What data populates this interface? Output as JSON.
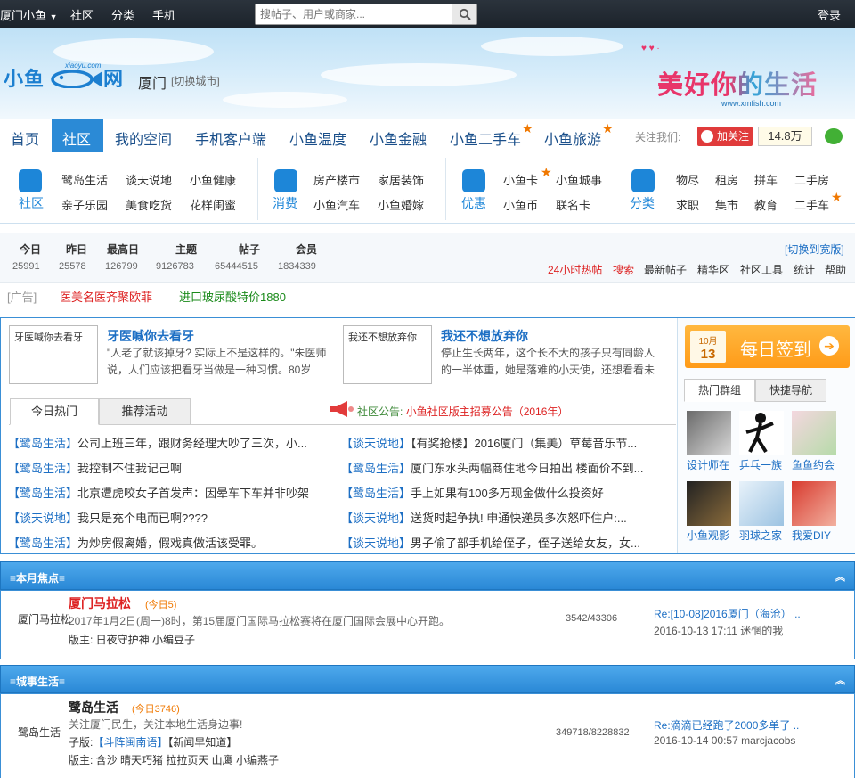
{
  "topbar": {
    "city_menu": "厦门小鱼",
    "community": "社区",
    "category": "分类",
    "mobile": "手机",
    "search_placeholder": "搜帖子、用户或商家...",
    "login": "登录"
  },
  "header": {
    "logo_text": "小鱼",
    "logo_text2": "网",
    "city": "厦门",
    "switch_city": "[切换城市]",
    "slogan": "美好你的生活",
    "slogan_url": "www.xmfish.com",
    "logo_url": "xiaoyu.com"
  },
  "nav": {
    "items": [
      "首页",
      "社区",
      "我的空间",
      "手机客户端",
      "小鱼温度",
      "小鱼金融",
      "小鱼二手车",
      "小鱼旅游"
    ],
    "follow_label": "关注我们:",
    "weibo_label": "加关注",
    "weibo_count": "14.8万"
  },
  "categories": [
    {
      "label": "社区",
      "links": [
        "鹭岛生活",
        "谈天说地",
        "小鱼健康",
        "亲子乐园",
        "美食吃货",
        "花样闺蜜"
      ]
    },
    {
      "label": "消费",
      "links": [
        "房产楼市",
        "家居装饰",
        "小鱼汽车",
        "小鱼婚嫁"
      ]
    },
    {
      "label": "优惠",
      "links": [
        "小鱼卡",
        "小鱼城事",
        "小鱼币",
        "联名卡"
      ]
    },
    {
      "label": "分类",
      "links": [
        "物尽",
        "租房",
        "拼车",
        "二手房",
        "求职",
        "集市",
        "教育",
        "二手车"
      ]
    }
  ],
  "stats": {
    "headers": [
      "今日",
      "昨日",
      "最高日",
      "主题",
      "帖子",
      "会员"
    ],
    "values": [
      "25991",
      "25578",
      "126799",
      "9126783",
      "65444515",
      "1834339"
    ],
    "switch_wide": "[切换到宽版]",
    "quick_links": [
      "24小时热帖",
      "搜索",
      "最新帖子",
      "精华区",
      "社区工具",
      "统计",
      "帮助"
    ]
  },
  "ads": {
    "label": "[广告]",
    "ad1": "医美名医齐聚欧菲",
    "ad2": "进口玻尿酸特价1880"
  },
  "featured": [
    {
      "thumb": "牙医喊你去看牙",
      "title": "牙医喊你去看牙",
      "desc": "\"人老了就该掉牙? 实际上不是这样的。\"朱医师说，人们应该把看牙当做是一种习惯。80岁"
    },
    {
      "thumb": "我还不想放弃你",
      "title": "我还不想放弃你",
      "desc": "停止生长两年，这个长不大的孩子只有同龄人的一半体重，她是落难的小天使，还想看看未"
    }
  ],
  "tabs": {
    "hot": "今日热门",
    "events": "推荐活动"
  },
  "notice": {
    "prefix": "社区公告:",
    "text": "小鱼社区版主招募公告（2016年）"
  },
  "hot_left": [
    {
      "forum": "【鹭岛生活】",
      "title": "公司上班三年，跟财务经理大吵了三次，小..."
    },
    {
      "forum": "【鹭岛生活】",
      "title": "我控制不住我记己啊"
    },
    {
      "forum": "【鹭岛生活】",
      "title": "北京遭虎咬女子首发声：因晕车下车并非吵架"
    },
    {
      "forum": "【谈天说地】",
      "title": "我只是充个电而已啊????"
    },
    {
      "forum": "【鹭岛生活】",
      "title": "为炒房假离婚，假戏真做活该受罪。"
    }
  ],
  "hot_right": [
    {
      "forum": "【谈天说地】",
      "title": "【有奖抢楼】2016厦门（集美）草莓音乐节..."
    },
    {
      "forum": "【鹭岛生活】",
      "title": "厦门东水头两幅商住地今日拍出 楼面价不到..."
    },
    {
      "forum": "【鹭岛生活】",
      "title": "手上如果有100多万现金做什么投资好"
    },
    {
      "forum": "【谈天说地】",
      "title": "送货时起争执! 申通快递员多次怒吓住户:..."
    },
    {
      "forum": "【谈天说地】",
      "title": "男子偷了部手机给侄子，侄子送给女友，女..."
    }
  ],
  "side": {
    "month": "10月",
    "day": "13",
    "sign_label": "每日签到",
    "tabs": [
      "热门群组",
      "快捷导航"
    ],
    "groups": [
      "设计师在",
      "乒乓一族",
      "鱼鱼约会",
      "小鱼观影",
      "羽球之家",
      "我爱DIY"
    ]
  },
  "sections": [
    {
      "title": "≡本月焦点≡",
      "forum_side": "厦门马拉松",
      "forum_name": "厦门马拉松",
      "today": "(今日5)",
      "desc": "2017年1月2日(周一)8时，第15届厦门国际马拉松赛将在厦门国际会展中心开跑。",
      "moderators": "版主: 日夜守护神 小编豆子",
      "counts": "3542/43306",
      "last_title": "Re:[10-08]2016厦门（海沧） ..",
      "last_meta": "2016-10-13 17:11 迷惘的我"
    },
    {
      "title": "≡城事生活≡",
      "forum_side": "鹭岛生活",
      "forum_name": "鹭岛生活",
      "today": "(今日3746)",
      "desc": "关注厦门民生，关注本地生活身边事!",
      "sub_label": "子版:",
      "sub1": "【斗阵闽南语】",
      "sub2": "【新闻早知道】",
      "moderators": "版主: 含沙 晴天巧猪 拉拉页天 山鹰 小编燕子",
      "counts": "349718/8228832",
      "last_title": "Re:滴滴已经跑了2000多单了 ..",
      "last_meta": "2016-10-14 00:57 marcjacobs"
    }
  ],
  "colors": {
    "brand_blue": "#2b8ad6",
    "accent_orange": "#f07800",
    "alert_red": "#d22"
  }
}
